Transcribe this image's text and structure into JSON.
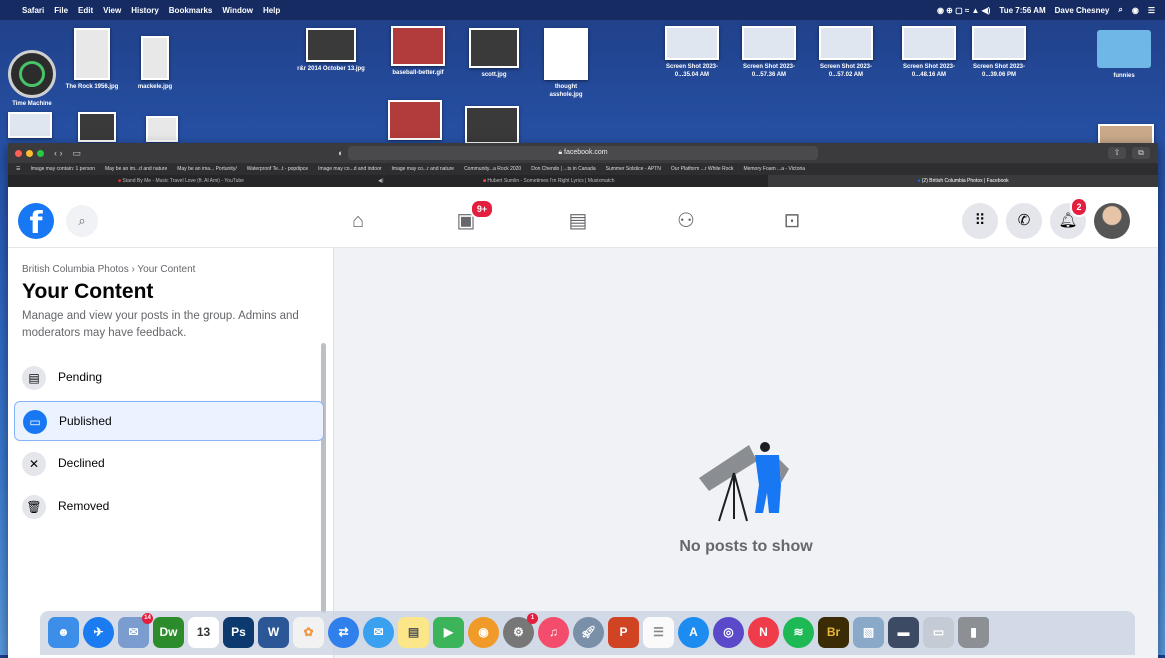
{
  "menubar": {
    "app": "Safari",
    "menus": [
      "File",
      "Edit",
      "View",
      "History",
      "Bookmarks",
      "Window",
      "Help"
    ],
    "clock": "Tue 7:56 AM",
    "user": "Dave Chesney"
  },
  "desktop": {
    "icons": [
      {
        "label": "Time Machine"
      },
      {
        "label": "The Rock 1956.jpg"
      },
      {
        "label": "mackele.jpg"
      },
      {
        "label": "r&r 2014 October 13.jpg"
      },
      {
        "label": "baseball-better.gif"
      },
      {
        "label": "scott.jpg"
      },
      {
        "label": "thought asshole.jpg"
      },
      {
        "label": "Screen Shot 2023-0...35.04 AM"
      },
      {
        "label": "Screen Shot 2023-0...57.36 AM"
      },
      {
        "label": "Screen Shot 2023-0...57.02 AM"
      },
      {
        "label": "Screen Shot 2023-0...48.16 AM"
      },
      {
        "label": "Screen Shot 2023-0...39.06 PM"
      },
      {
        "label": "funnies"
      }
    ]
  },
  "browser": {
    "url": "facebook.com",
    "bookmarks": [
      "Image may contain: 1 person",
      "May be an im...d and nature",
      "May be an ima... Portunity/",
      "Waterproof Te...t - popdipce",
      "Image may co...d and indoor",
      "Image may co...r and nature",
      "Community...a Rock 2020",
      "Don Chendo | ...ts in Canada",
      "Summer Solstice - APTN",
      "Our Platform ...r White Rock",
      "Memory Foam ...a - Victoria"
    ],
    "tabs": [
      {
        "title": "Stand By Me - Music Travel Love (ft. Al Ami) - YouTube"
      },
      {
        "title": "Hubert Sumlin - Sometimes I'm Right Lyrics | Musixmatch"
      },
      {
        "title": "(2) British Columbia Photos | Facebook"
      }
    ]
  },
  "facebook": {
    "watch_badge": "9+",
    "notifications_badge": "2",
    "breadcrumb": "British Columbia Photos › Your Content",
    "title": "Your Content",
    "description": "Manage and view your posts in the group. Admins and moderators may have feedback.",
    "sidebar_items": [
      {
        "label": "Pending",
        "icon": "pending-icon"
      },
      {
        "label": "Published",
        "icon": "published-icon",
        "active": true
      },
      {
        "label": "Declined",
        "icon": "declined-icon"
      },
      {
        "label": "Removed",
        "icon": "trash-icon"
      }
    ],
    "empty_state": "No posts to show",
    "accent": "#1877f2"
  },
  "dock": {
    "badges": {
      "photos": "14",
      "calendar": "13",
      "system_prefs": "1"
    }
  }
}
